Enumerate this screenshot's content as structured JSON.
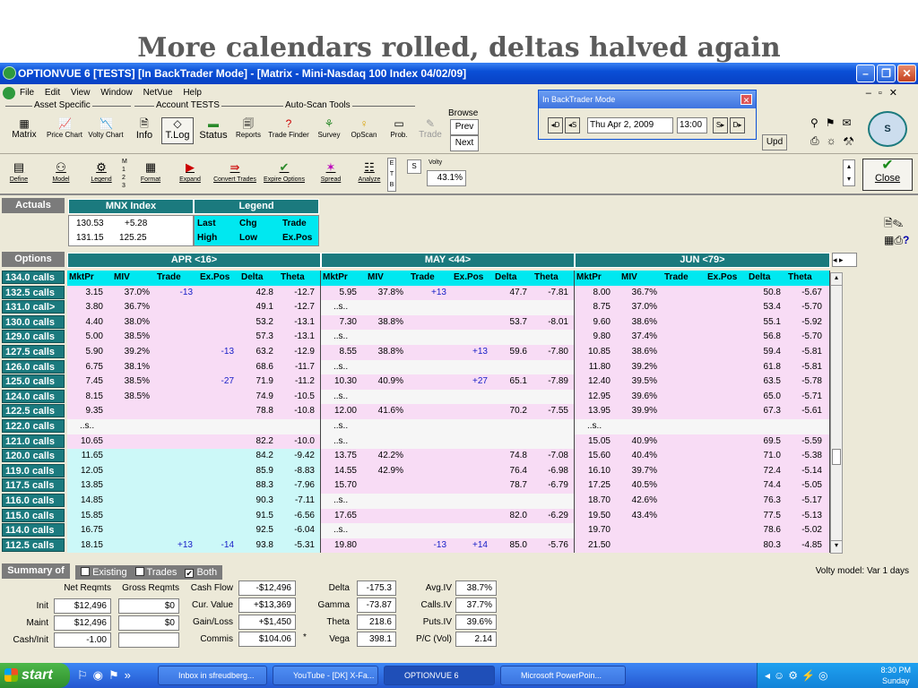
{
  "slide_title": "More calendars rolled, deltas halved again",
  "window": {
    "title": "OPTIONVUE 6   [TESTS]   [In BackTrader Mode] - [Matrix - Mini-Nasdaq 100 Index  04/02/09]"
  },
  "menu": [
    "File",
    "Edit",
    "View",
    "Window",
    "NetVue",
    "Help"
  ],
  "toolbar1": {
    "group_asset": "Asset Specific",
    "group_account": "Account TESTS",
    "group_autoscan": "Auto-Scan Tools",
    "browse": "Browse",
    "buttons": [
      "Matrix",
      "Price Chart",
      "Volty Chart",
      "Info",
      "T.Log",
      "Status",
      "Reports",
      "Trade Finder",
      "Survey",
      "OpScan",
      "Prob.",
      "Trade"
    ],
    "prev": "Prev",
    "next": "Next",
    "upd": "Upd"
  },
  "backtrader": {
    "title": "In BackTrader Mode",
    "date": "Thu Apr 2, 2009",
    "time": "13:00",
    "btn_d1": "D",
    "btn_s1": "S",
    "btn_s2": "S",
    "btn_d2": "D"
  },
  "toolbar2": {
    "buttons": [
      "Define",
      "Model",
      "Legend",
      "Format",
      "Expand",
      "Convert Trades",
      "Expire Options",
      "Spread",
      "Analyze"
    ],
    "mini": [
      "M",
      "1",
      "2",
      "3"
    ],
    "etb": [
      "E",
      "T",
      "B"
    ],
    "volty_label": "Volty",
    "volty_s": "S",
    "volty_value": "43.1%",
    "close": "Close"
  },
  "actuals": {
    "label": "Actuals",
    "index_header": "MNX Index",
    "legend_header": "Legend",
    "r1": [
      "130.53",
      "+5.28"
    ],
    "r2": [
      "131.15",
      "125.25"
    ],
    "legend": [
      "Last",
      "Chg",
      "Trade",
      "High",
      "Low",
      "Ex.Pos"
    ]
  },
  "options_label": "Options",
  "months": [
    "APR <16>",
    "MAY <44>",
    "JUN <79>"
  ],
  "col_headers": [
    "MktPr",
    "MIV",
    "Trade",
    "Ex.Pos",
    "Delta",
    "Theta"
  ],
  "rows": [
    {
      "l": "134.0 calls",
      "a": [
        "MktPr",
        "MIV",
        "Trade",
        "Ex.Pos",
        "Delta",
        "Theta"
      ],
      "hdr": true
    },
    {
      "l": "132.5 calls",
      "a": [
        "3.15",
        "37.0%",
        "-13",
        "",
        "42.8",
        "-12.7"
      ],
      "m": [
        "5.95",
        "37.8%",
        "+13",
        "",
        "47.7",
        "-7.81"
      ],
      "j": [
        "8.00",
        "36.7%",
        "",
        "",
        "50.8",
        "-5.67"
      ]
    },
    {
      "l": "131.0 call>",
      "a": [
        "3.80",
        "36.7%",
        "",
        "",
        "49.1",
        "-12.7"
      ],
      "m": [
        "..s..",
        "",
        "",
        "",
        "",
        ""
      ],
      "j": [
        "8.75",
        "37.0%",
        "",
        "",
        "53.4",
        "-5.70"
      ]
    },
    {
      "l": "130.0 calls",
      "a": [
        "4.40",
        "38.0%",
        "",
        "",
        "53.2",
        "-13.1"
      ],
      "m": [
        "7.30",
        "38.8%",
        "",
        "",
        "53.7",
        "-8.01"
      ],
      "j": [
        "9.60",
        "38.6%",
        "",
        "",
        "55.1",
        "-5.92"
      ]
    },
    {
      "l": "129.0 calls",
      "a": [
        "5.00",
        "38.5%",
        "",
        "",
        "57.3",
        "-13.1"
      ],
      "m": [
        "..s..",
        "",
        "",
        "",
        "",
        ""
      ],
      "j": [
        "9.80",
        "37.4%",
        "",
        "",
        "56.8",
        "-5.70"
      ]
    },
    {
      "l": "127.5 calls",
      "a": [
        "5.90",
        "39.2%",
        "",
        "-13",
        "63.2",
        "-12.9"
      ],
      "m": [
        "8.55",
        "38.8%",
        "",
        "+13",
        "59.6",
        "-7.80"
      ],
      "j": [
        "10.85",
        "38.6%",
        "",
        "",
        "59.4",
        "-5.81"
      ]
    },
    {
      "l": "126.0 calls",
      "a": [
        "6.75",
        "38.1%",
        "",
        "",
        "68.6",
        "-11.7"
      ],
      "m": [
        "..s..",
        "",
        "",
        "",
        "",
        ""
      ],
      "j": [
        "11.80",
        "39.2%",
        "",
        "",
        "61.8",
        "-5.81"
      ]
    },
    {
      "l": "125.0 calls",
      "a": [
        "7.45",
        "38.5%",
        "",
        "-27",
        "71.9",
        "-11.2"
      ],
      "m": [
        "10.30",
        "40.9%",
        "",
        "+27",
        "65.1",
        "-7.89"
      ],
      "j": [
        "12.40",
        "39.5%",
        "",
        "",
        "63.5",
        "-5.78"
      ]
    },
    {
      "l": "124.0 calls",
      "a": [
        "8.15",
        "38.5%",
        "",
        "",
        "74.9",
        "-10.5"
      ],
      "m": [
        "..s..",
        "",
        "",
        "",
        "",
        ""
      ],
      "j": [
        "12.95",
        "39.6%",
        "",
        "",
        "65.0",
        "-5.71"
      ]
    },
    {
      "l": "122.5 calls",
      "a": [
        "9.35",
        "",
        "",
        "",
        "78.8",
        "-10.8"
      ],
      "m": [
        "12.00",
        "41.6%",
        "",
        "",
        "70.2",
        "-7.55"
      ],
      "j": [
        "13.95",
        "39.9%",
        "",
        "",
        "67.3",
        "-5.61"
      ]
    },
    {
      "l": "122.0 calls",
      "a": [
        "..s..",
        "",
        "",
        "",
        "",
        ""
      ],
      "m": [
        "..s..",
        "",
        "",
        "",
        "",
        ""
      ],
      "j": [
        "..s..",
        "",
        "",
        "",
        "",
        ""
      ]
    },
    {
      "l": "121.0 calls",
      "a": [
        "10.65",
        "",
        "",
        "",
        "82.2",
        "-10.0"
      ],
      "m": [
        "..s..",
        "",
        "",
        "",
        "",
        ""
      ],
      "j": [
        "15.05",
        "40.9%",
        "",
        "",
        "69.5",
        "-5.59"
      ]
    },
    {
      "l": "120.0 calls",
      "a": [
        "11.65",
        "",
        "",
        "",
        "84.2",
        "-9.42"
      ],
      "m": [
        "13.75",
        "42.2%",
        "",
        "",
        "74.8",
        "-7.08"
      ],
      "j": [
        "15.60",
        "40.4%",
        "",
        "",
        "71.0",
        "-5.38"
      ]
    },
    {
      "l": "119.0 calls",
      "a": [
        "12.05",
        "",
        "",
        "",
        "85.9",
        "-8.83"
      ],
      "m": [
        "14.55",
        "42.9%",
        "",
        "",
        "76.4",
        "-6.98"
      ],
      "j": [
        "16.10",
        "39.7%",
        "",
        "",
        "72.4",
        "-5.14"
      ]
    },
    {
      "l": "117.5 calls",
      "a": [
        "13.85",
        "",
        "",
        "",
        "88.3",
        "-7.96"
      ],
      "m": [
        "15.70",
        "",
        "",
        "",
        "78.7",
        "-6.79"
      ],
      "j": [
        "17.25",
        "40.5%",
        "",
        "",
        "74.4",
        "-5.05"
      ]
    },
    {
      "l": "116.0 calls",
      "a": [
        "14.85",
        "",
        "",
        "",
        "90.3",
        "-7.11"
      ],
      "m": [
        "..s..",
        "",
        "",
        "",
        "",
        ""
      ],
      "j": [
        "18.70",
        "42.6%",
        "",
        "",
        "76.3",
        "-5.17"
      ]
    },
    {
      "l": "115.0 calls",
      "a": [
        "15.85",
        "",
        "",
        "",
        "91.5",
        "-6.56"
      ],
      "m": [
        "17.65",
        "",
        "",
        "",
        "82.0",
        "-6.29"
      ],
      "j": [
        "19.50",
        "43.4%",
        "",
        "",
        "77.5",
        "-5.13"
      ]
    },
    {
      "l": "114.0 calls",
      "a": [
        "16.75",
        "",
        "",
        "",
        "92.5",
        "-6.04"
      ],
      "m": [
        "..s..",
        "",
        "",
        "",
        "",
        ""
      ],
      "j": [
        "19.70",
        "",
        "",
        "",
        "78.6",
        "-5.02"
      ]
    },
    {
      "l": "112.5 calls",
      "a": [
        "18.15",
        "",
        "+13",
        "-14",
        "93.8",
        "-5.31"
      ],
      "m": [
        "19.80",
        "",
        "-13",
        "+14",
        "85.0",
        "-5.76"
      ],
      "j": [
        "21.50",
        "",
        "",
        "",
        "80.3",
        "-4.85"
      ]
    }
  ],
  "summary": {
    "label": "Summary of",
    "existing": "Existing",
    "trades": "Trades",
    "both": "Both",
    "volty_model": "Volty model: Var 1 days",
    "net": "Net Reqmts",
    "gross": "Gross Reqmts",
    "rows_left": [
      [
        "Init",
        "$12,496",
        "$0"
      ],
      [
        "Maint",
        "$12,496",
        "$0"
      ],
      [
        "Cash/Init",
        "-1.00",
        ""
      ]
    ],
    "mid": [
      [
        "Cash Flow",
        "-$12,496"
      ],
      [
        "Cur. Value",
        "+$13,369"
      ],
      [
        "Gain/Loss",
        "+$1,450"
      ],
      [
        "Commis",
        "$104.06"
      ]
    ],
    "greek": [
      [
        "Delta",
        "-175.3"
      ],
      [
        "Gamma",
        "-73.87"
      ],
      [
        "Theta",
        "218.6"
      ],
      [
        "Vega",
        "398.1"
      ]
    ],
    "iv": [
      [
        "Avg.IV",
        "38.7%"
      ],
      [
        "Calls.IV",
        "37.7%"
      ],
      [
        "Puts.IV",
        "39.6%"
      ],
      [
        "P/C (Vol)",
        "2.14"
      ]
    ],
    "star": "*"
  },
  "taskbar": {
    "start": "start",
    "tasks": [
      "Inbox in sfreudberg...",
      "YouTube - [DK] X-Fa...",
      "OPTIONVUE 6",
      "Microsoft PowerPoin..."
    ],
    "time": "8:30 PM",
    "day": "Sunday"
  }
}
